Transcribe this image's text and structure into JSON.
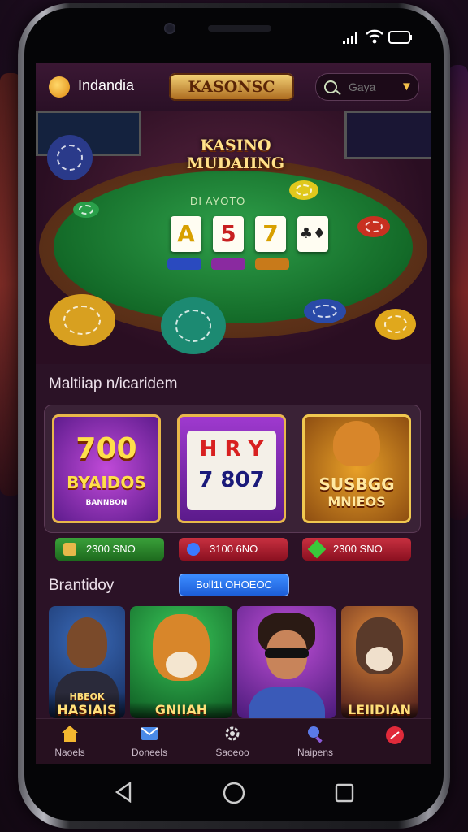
{
  "status_bar": {
    "signal_icon": "signal-icon",
    "wifi_icon": "wifi-icon",
    "battery_icon": "battery-icon"
  },
  "header": {
    "brand_name": "Indandia",
    "logo_text": "KASONSC",
    "search_placeholder": "Gaya"
  },
  "hero": {
    "title_line1": "KASINO",
    "title_line2": "MUDAIING",
    "felt_text": "DI AYOTO",
    "cards": [
      "A",
      "5",
      "7",
      ""
    ]
  },
  "section1": {
    "title": "Maltiiap n/icaridem"
  },
  "slots": [
    {
      "top": "700",
      "bottom": "BYAIDOS",
      "caption": "BANNBON"
    },
    {
      "row1": "H R Y",
      "row2": "7 807"
    },
    {
      "line1": "SUSBGG",
      "line2": "MNIEOS"
    }
  ],
  "bets": [
    {
      "value": "2300 SNO",
      "color": "#2f8a2a"
    },
    {
      "value": "3100 6NO",
      "color": "#b01f2a"
    },
    {
      "value": "2300 SNO",
      "color": "#b01f2a"
    }
  ],
  "section2": {
    "title": "Brantidoy",
    "button": "Boll1t OHOEOC"
  },
  "tiles": [
    {
      "label": "HASIAIS",
      "kicker": "HBEOK"
    },
    {
      "label": "GNIIAH"
    },
    {
      "label": ""
    },
    {
      "label": "LEIIDIAN"
    }
  ],
  "nav": [
    {
      "label": "Naoels",
      "icon": "home-icon"
    },
    {
      "label": "Doneels",
      "icon": "mail-icon"
    },
    {
      "label": "Saoeoo",
      "icon": "gear-icon"
    },
    {
      "label": "Naipens",
      "icon": "magnifier-icon"
    },
    {
      "label": "",
      "icon": "red-badge-icon"
    }
  ],
  "colors": {
    "accent": "#f3c04a",
    "screen_bg": "#2b1226",
    "cta": "#2a6fe8"
  }
}
